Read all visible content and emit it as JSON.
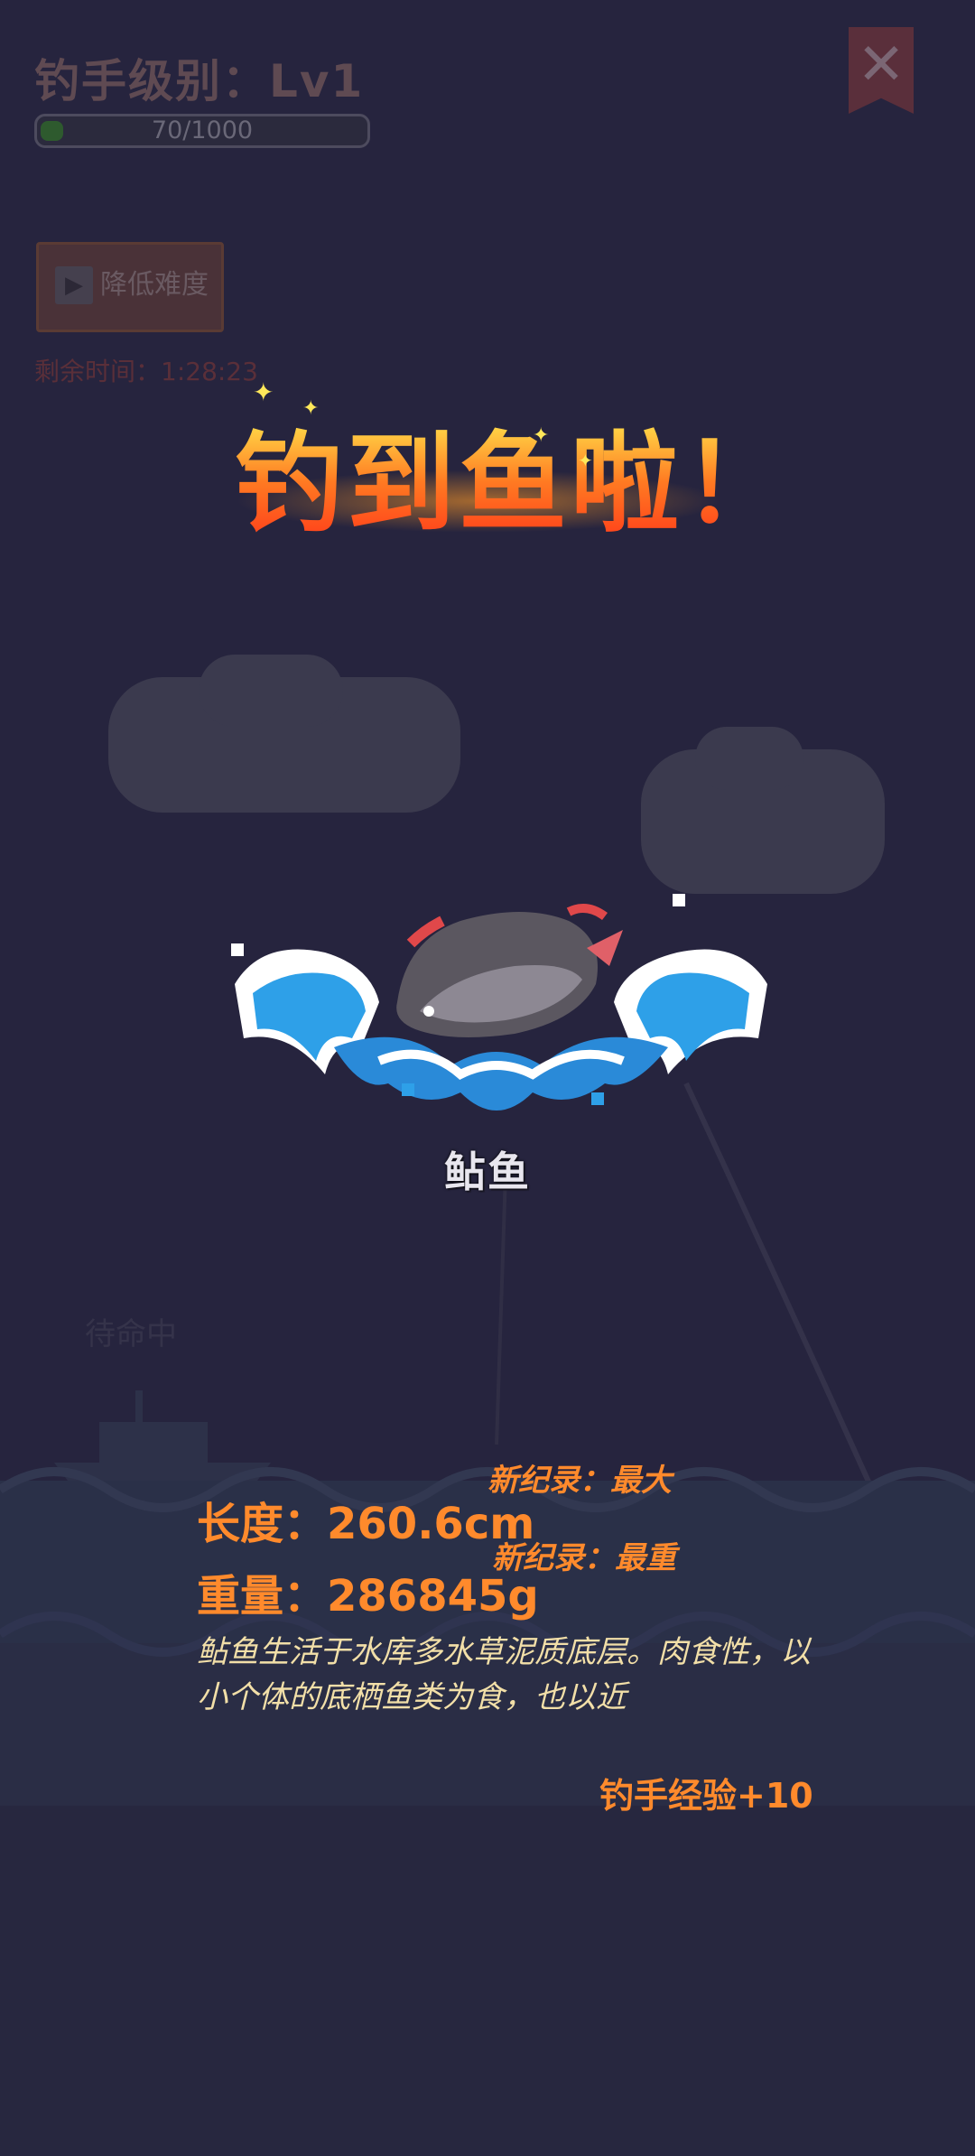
{
  "hud": {
    "level_label": "钓手级别：Lv1",
    "xp_text": "70/1000",
    "xp_progress": 0.07,
    "ease_button_label": "降低难度",
    "timer_text": "剩余时间：1:28:23",
    "standby_text": "待命中"
  },
  "catch": {
    "headline": "钓到鱼啦！",
    "fish_name": "鲇鱼",
    "length_text": "长度：260.6cm",
    "weight_text": "重量：286845g",
    "record_max": "新纪录：最大",
    "record_heavy": "新纪录：最重",
    "description": "鲇鱼生活于水库多水草泥质底层。肉食性，以小个体的底栖鱼类为食，也以近",
    "exp_gain": "钓手经验+10"
  },
  "icons": {
    "close": "close-icon",
    "play": "play-icon",
    "sparkle": "sparkle-icon"
  },
  "colors": {
    "background": "#26243e",
    "headline_top": "#ffe04a",
    "headline_bottom": "#ff3b1a",
    "stat_orange": "#ff8a2c",
    "description": "#f2dfa8",
    "wave_blue": "#2ea0e8"
  }
}
